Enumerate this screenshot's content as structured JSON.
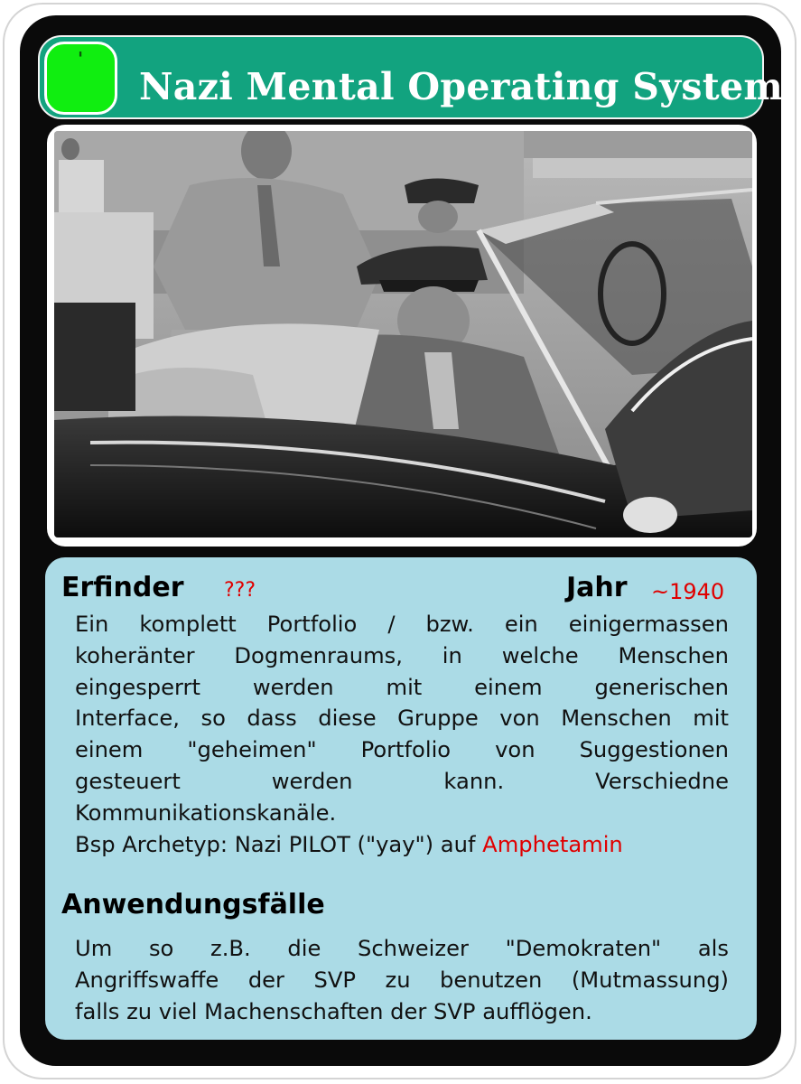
{
  "card": {
    "title": "Nazi Mental Operating System",
    "badge_mark": "'",
    "colors": {
      "header": "#12a37f",
      "badge": "#10ee10",
      "info_panel": "#abdbe6",
      "card_border": "#0a0a0a",
      "highlight": "#e00000"
    }
  },
  "photo": {
    "icon": "black-and-white-photo"
  },
  "info": {
    "inventor_label": "Erfinder",
    "inventor_value": "???",
    "year_label": "Jahr",
    "year_value": "~1940",
    "description_lines": [
      "Ein komplett Portfolio / bzw. ein einigermassen",
      "koheränter Dogmenraums, in welche Menschen",
      "eingesperrt werden mit einem generischen",
      "Interface, so dass diese Gruppe von Menschen mit",
      "einem \"geheimen\" Portfolio von Suggestionen",
      "gesteuert werden kann. Verschiedne",
      "Kommunikationskanäle."
    ],
    "example_prefix": "Bsp Archetyp: Nazi PILOT (\"yay\") auf ",
    "example_highlight": "Amphetamin",
    "usecases_label": "Anwendungsfälle",
    "usecases_lines": [
      "Um so z.B. die Schweizer \"Demokraten\" als",
      "Angriffswaffe der SVP zu benutzen (Mutmassung)",
      "falls zu viel Machenschaften der SVP aufflögen."
    ]
  }
}
